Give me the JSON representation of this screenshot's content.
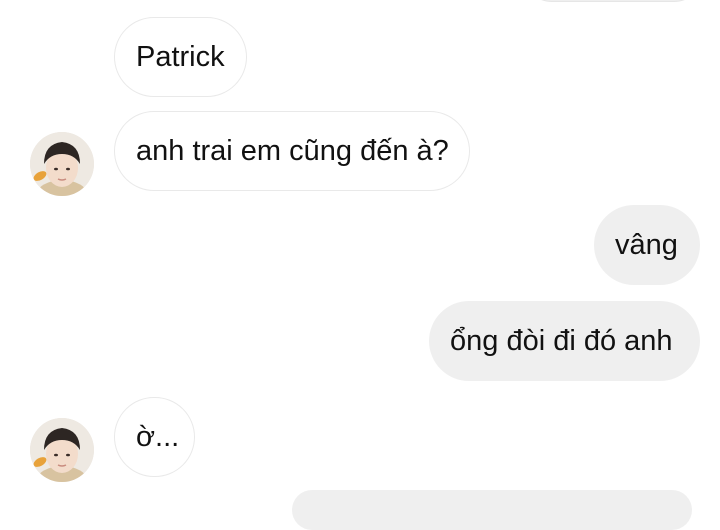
{
  "messages": [
    {
      "id": "m1",
      "direction": "incoming",
      "text": "Patrick",
      "avatar": false
    },
    {
      "id": "m2",
      "direction": "incoming",
      "text": "anh trai em cũng đến à?",
      "avatar": true
    },
    {
      "id": "m3",
      "direction": "outgoing",
      "text": "vâng"
    },
    {
      "id": "m4",
      "direction": "outgoing",
      "text": "ổng đòi đi đó anh"
    },
    {
      "id": "m5",
      "direction": "incoming",
      "text": "ờ...",
      "avatar": true
    }
  ],
  "colors": {
    "outgoing_bubble": "#efefef",
    "incoming_bubble": "#ffffff",
    "incoming_border": "#e9e9e9",
    "text": "#111111"
  },
  "icons": {
    "sender_avatar": "profile-photo"
  }
}
